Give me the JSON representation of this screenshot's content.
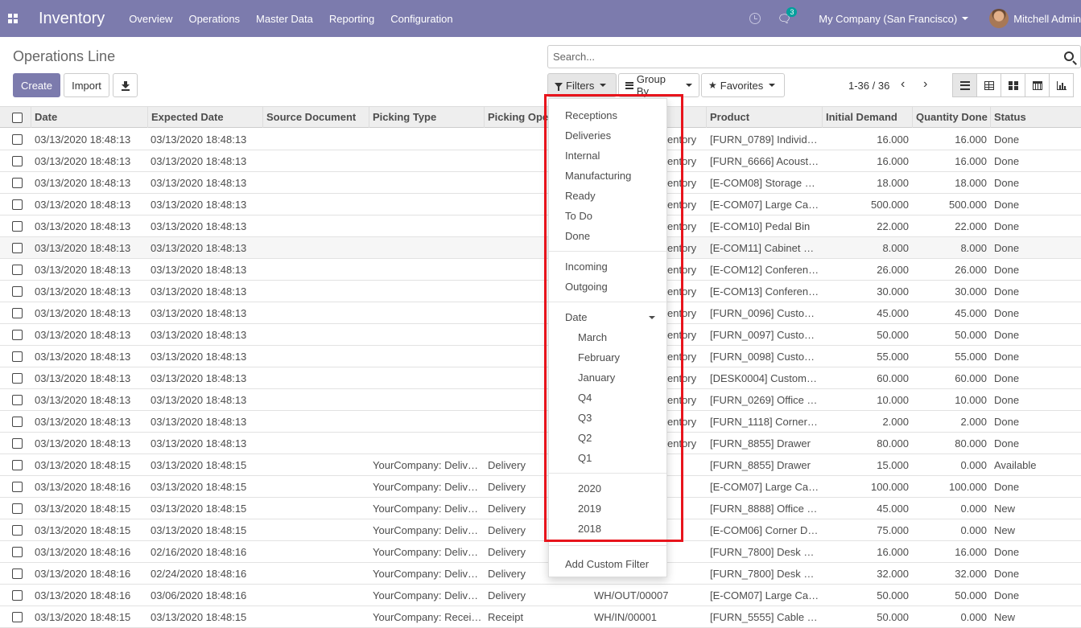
{
  "navbar": {
    "app_title": "Inventory",
    "menu": [
      "Overview",
      "Operations",
      "Master Data",
      "Reporting",
      "Configuration"
    ],
    "chat_badge": "3",
    "company": "My Company (San Francisco)",
    "user": "Mitchell Admin"
  },
  "page": {
    "title": "Operations Line",
    "create_label": "Create",
    "import_label": "Import"
  },
  "search": {
    "placeholder": "Search..."
  },
  "search_panel": {
    "filters_label": "Filters",
    "group_by_label": "Group By",
    "favorites_label": "Favorites"
  },
  "pager": {
    "value": "1-36 / 36"
  },
  "columns": [
    "Date",
    "Expected Date",
    "Source Document",
    "Picking Type",
    "Picking Ope",
    "Product",
    "Initial Demand",
    "Quantity Done",
    "Status"
  ],
  "rows": [
    {
      "date": "03/13/2020 18:48:13",
      "expected": "03/13/2020 18:48:13",
      "source": "",
      "picking_type": "",
      "op": "",
      "ref": "entory",
      "product": "[FURN_0789] Individ…",
      "demand": "16.000",
      "done": "16.000",
      "status": "Done"
    },
    {
      "date": "03/13/2020 18:48:13",
      "expected": "03/13/2020 18:48:13",
      "source": "",
      "picking_type": "",
      "op": "",
      "ref": "entory",
      "product": "[FURN_6666] Acoust…",
      "demand": "16.000",
      "done": "16.000",
      "status": "Done"
    },
    {
      "date": "03/13/2020 18:48:13",
      "expected": "03/13/2020 18:48:13",
      "source": "",
      "picking_type": "",
      "op": "",
      "ref": "entory",
      "product": "[E-COM08] Storage …",
      "demand": "18.000",
      "done": "18.000",
      "status": "Done"
    },
    {
      "date": "03/13/2020 18:48:13",
      "expected": "03/13/2020 18:48:13",
      "source": "",
      "picking_type": "",
      "op": "",
      "ref": "entory",
      "product": "[E-COM07] Large Ca…",
      "demand": "500.000",
      "done": "500.000",
      "status": "Done"
    },
    {
      "date": "03/13/2020 18:48:13",
      "expected": "03/13/2020 18:48:13",
      "source": "",
      "picking_type": "",
      "op": "",
      "ref": "entory",
      "product": "[E-COM10] Pedal Bin",
      "demand": "22.000",
      "done": "22.000",
      "status": "Done"
    },
    {
      "date": "03/13/2020 18:48:13",
      "expected": "03/13/2020 18:48:13",
      "source": "",
      "picking_type": "",
      "op": "",
      "ref": "entory",
      "product": "[E-COM11] Cabinet …",
      "demand": "8.000",
      "done": "8.000",
      "status": "Done"
    },
    {
      "date": "03/13/2020 18:48:13",
      "expected": "03/13/2020 18:48:13",
      "source": "",
      "picking_type": "",
      "op": "",
      "ref": "entory",
      "product": "[E-COM12] Conferen…",
      "demand": "26.000",
      "done": "26.000",
      "status": "Done"
    },
    {
      "date": "03/13/2020 18:48:13",
      "expected": "03/13/2020 18:48:13",
      "source": "",
      "picking_type": "",
      "op": "",
      "ref": "entory",
      "product": "[E-COM13] Conferen…",
      "demand": "30.000",
      "done": "30.000",
      "status": "Done"
    },
    {
      "date": "03/13/2020 18:48:13",
      "expected": "03/13/2020 18:48:13",
      "source": "",
      "picking_type": "",
      "op": "",
      "ref": "entory",
      "product": "[FURN_0096] Custo…",
      "demand": "45.000",
      "done": "45.000",
      "status": "Done"
    },
    {
      "date": "03/13/2020 18:48:13",
      "expected": "03/13/2020 18:48:13",
      "source": "",
      "picking_type": "",
      "op": "",
      "ref": "entory",
      "product": "[FURN_0097] Custo…",
      "demand": "50.000",
      "done": "50.000",
      "status": "Done"
    },
    {
      "date": "03/13/2020 18:48:13",
      "expected": "03/13/2020 18:48:13",
      "source": "",
      "picking_type": "",
      "op": "",
      "ref": "entory",
      "product": "[FURN_0098] Custo…",
      "demand": "55.000",
      "done": "55.000",
      "status": "Done"
    },
    {
      "date": "03/13/2020 18:48:13",
      "expected": "03/13/2020 18:48:13",
      "source": "",
      "picking_type": "",
      "op": "",
      "ref": "entory",
      "product": "[DESK0004] Custom…",
      "demand": "60.000",
      "done": "60.000",
      "status": "Done"
    },
    {
      "date": "03/13/2020 18:48:13",
      "expected": "03/13/2020 18:48:13",
      "source": "",
      "picking_type": "",
      "op": "",
      "ref": "entory",
      "product": "[FURN_0269] Office …",
      "demand": "10.000",
      "done": "10.000",
      "status": "Done"
    },
    {
      "date": "03/13/2020 18:48:13",
      "expected": "03/13/2020 18:48:13",
      "source": "",
      "picking_type": "",
      "op": "",
      "ref": "entory",
      "product": "[FURN_1118] Corner…",
      "demand": "2.000",
      "done": "2.000",
      "status": "Done"
    },
    {
      "date": "03/13/2020 18:48:13",
      "expected": "03/13/2020 18:48:13",
      "source": "",
      "picking_type": "",
      "op": "",
      "ref": "entory",
      "product": "[FURN_8855] Drawer",
      "demand": "80.000",
      "done": "80.000",
      "status": "Done"
    },
    {
      "date": "03/13/2020 18:48:15",
      "expected": "03/13/2020 18:48:15",
      "source": "",
      "picking_type": "YourCompany: Deliv…",
      "op": "Delivery",
      "ref": "",
      "product": "[FURN_8855] Drawer",
      "demand": "15.000",
      "done": "0.000",
      "status": "Available"
    },
    {
      "date": "03/13/2020 18:48:16",
      "expected": "03/13/2020 18:48:15",
      "source": "",
      "picking_type": "YourCompany: Deliv…",
      "op": "Delivery",
      "ref": "",
      "product": "[E-COM07] Large Ca…",
      "demand": "100.000",
      "done": "100.000",
      "status": "Done"
    },
    {
      "date": "03/13/2020 18:48:15",
      "expected": "03/13/2020 18:48:15",
      "source": "",
      "picking_type": "YourCompany: Deliv…",
      "op": "Delivery",
      "ref": "",
      "product": "[FURN_8888] Office …",
      "demand": "45.000",
      "done": "0.000",
      "status": "New"
    },
    {
      "date": "03/13/2020 18:48:15",
      "expected": "03/13/2020 18:48:15",
      "source": "",
      "picking_type": "YourCompany: Deliv…",
      "op": "Delivery",
      "ref": "",
      "product": "[E-COM06] Corner D…",
      "demand": "75.000",
      "done": "0.000",
      "status": "New"
    },
    {
      "date": "03/13/2020 18:48:16",
      "expected": "02/16/2020 18:48:16",
      "source": "",
      "picking_type": "YourCompany: Deliv…",
      "op": "Delivery",
      "ref": "",
      "product": "[FURN_7800] Desk …",
      "demand": "16.000",
      "done": "16.000",
      "status": "Done"
    },
    {
      "date": "03/13/2020 18:48:16",
      "expected": "02/24/2020 18:48:16",
      "source": "",
      "picking_type": "YourCompany: Deliv…",
      "op": "Delivery",
      "ref": "",
      "product": "[FURN_7800] Desk …",
      "demand": "32.000",
      "done": "32.000",
      "status": "Done"
    },
    {
      "date": "03/13/2020 18:48:16",
      "expected": "03/06/2020 18:48:16",
      "source": "",
      "picking_type": "YourCompany: Deliv…",
      "op": "Delivery",
      "ref": "WH/OUT/00007",
      "product": "[E-COM07] Large Ca…",
      "demand": "50.000",
      "done": "50.000",
      "status": "Done"
    },
    {
      "date": "03/13/2020 18:48:15",
      "expected": "03/13/2020 18:48:15",
      "source": "",
      "picking_type": "YourCompany: Recei…",
      "op": "Receipt",
      "ref": "WH/IN/00001",
      "product": "[FURN_5555] Cable …",
      "demand": "50.000",
      "done": "0.000",
      "status": "New"
    }
  ],
  "filters_menu": {
    "group1": [
      "Receptions",
      "Deliveries",
      "Internal",
      "Manufacturing",
      "Ready",
      "To Do",
      "Done"
    ],
    "group2": [
      "Incoming",
      "Outgoing"
    ],
    "date_label": "Date",
    "date_options": [
      "March",
      "February",
      "January",
      "Q4",
      "Q3",
      "Q2",
      "Q1"
    ],
    "years": [
      "2020",
      "2019",
      "2018"
    ],
    "add_custom": "Add Custom Filter"
  }
}
